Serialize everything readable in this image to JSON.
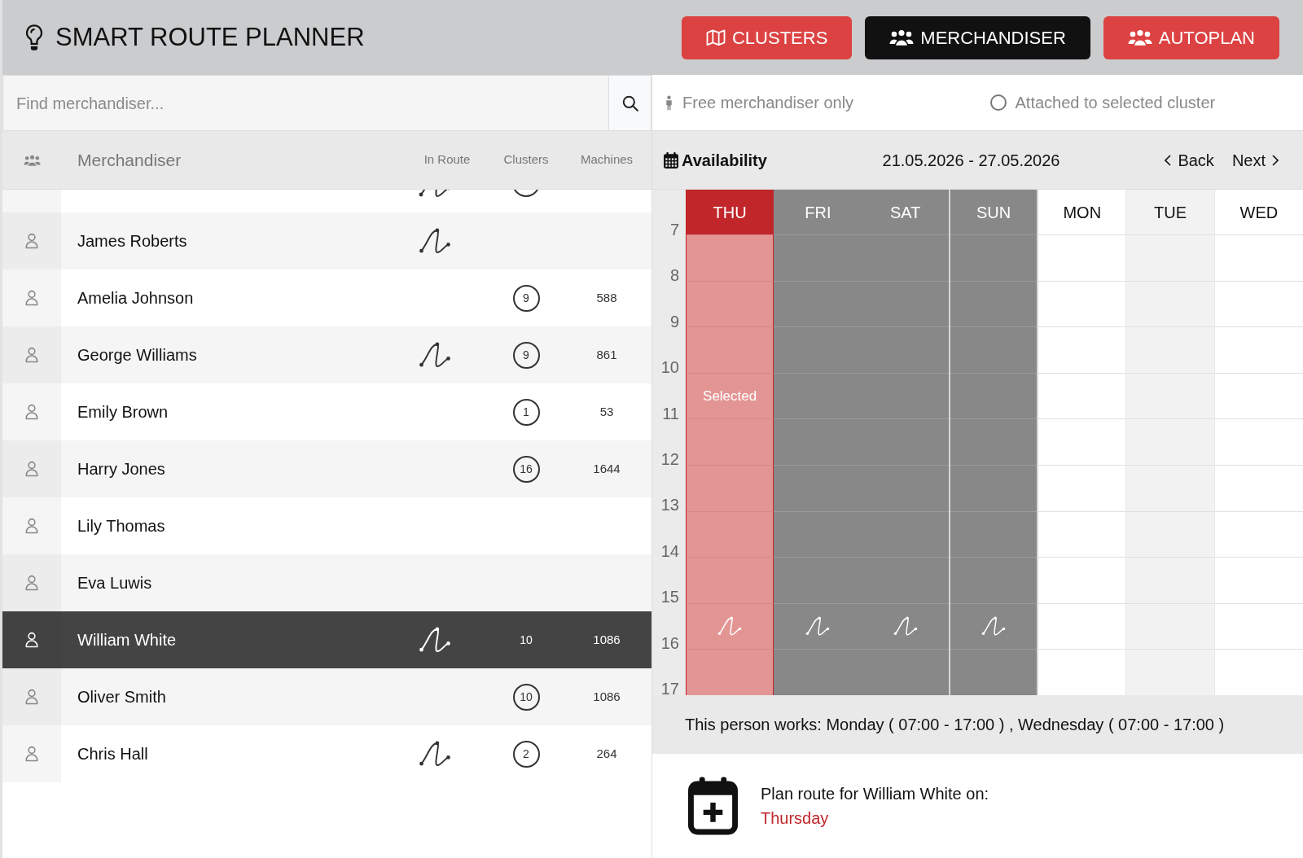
{
  "app": {
    "title": "SMART ROUTE PLANNER"
  },
  "nav_buttons": [
    {
      "label": "CLUSTERS",
      "selected": false
    },
    {
      "label": "MERCHANDISER",
      "selected": true
    },
    {
      "label": "AUTOPLAN",
      "selected": false
    }
  ],
  "search": {
    "placeholder": "Find merchandiser..."
  },
  "filters": {
    "free_only": {
      "label": "Free merchandiser only"
    },
    "attached": {
      "label": "Attached to selected cluster",
      "checked": false
    }
  },
  "list": {
    "columns": [
      "Merchandiser",
      "In Route",
      "Clusters",
      "Machines"
    ],
    "clipped_top_row": {
      "in_route": true,
      "clusters_shown": true
    },
    "rows": [
      {
        "name": "James Roberts",
        "selected": false,
        "in_route": true
      },
      {
        "name": "Amelia Johnson",
        "selected": false,
        "in_route": false,
        "clusters": "9",
        "machines": "588"
      },
      {
        "name": "George Williams",
        "selected": false,
        "in_route": true,
        "clusters": "9",
        "machines": "861"
      },
      {
        "name": "Emily Brown",
        "selected": false,
        "in_route": false,
        "clusters": "1",
        "machines": "53"
      },
      {
        "name": "Harry Jones",
        "selected": false,
        "in_route": false,
        "clusters": "16",
        "machines": "1644"
      },
      {
        "name": "Lily Thomas",
        "selected": false,
        "in_route": false
      },
      {
        "name": "Eva Luwis",
        "selected": false,
        "in_route": false
      },
      {
        "name": "William White",
        "selected": true,
        "in_route": true,
        "clusters": "10",
        "machines": "1086"
      },
      {
        "name": "Oliver Smith",
        "selected": false,
        "in_route": false,
        "clusters": "10",
        "machines": "1086"
      },
      {
        "name": "Chris Hall",
        "selected": false,
        "in_route": true,
        "clusters": "2",
        "machines": "264"
      }
    ]
  },
  "availability": {
    "title": "Availability",
    "range": "21.05.2026 - 27.05.2026",
    "back": "Back",
    "next": "Next",
    "hours": [
      "7",
      "8",
      "9",
      "10",
      "11",
      "12",
      "13",
      "14",
      "15",
      "16",
      "17"
    ],
    "days": [
      {
        "label": "THU",
        "selected": true,
        "busy": true,
        "route": true,
        "note": "Selected"
      },
      {
        "label": "FRI",
        "selected": false,
        "busy": true,
        "route": true
      },
      {
        "label": "SAT",
        "selected": false,
        "busy": true,
        "route": true
      },
      {
        "label": "SUN",
        "selected": false,
        "busy": true,
        "route": true
      },
      {
        "label": "MON",
        "selected": false,
        "busy": false,
        "route": false
      },
      {
        "label": "TUE",
        "selected": false,
        "busy": false,
        "route": false
      },
      {
        "label": "WED",
        "selected": false,
        "busy": false,
        "route": false
      }
    ],
    "works_note": "This person works: Monday ( 07:00 - 17:00 ) , Wednesday ( 07:00 - 17:00 )"
  },
  "plan": {
    "text": "Plan route for William White on:",
    "day": "Thursday"
  }
}
